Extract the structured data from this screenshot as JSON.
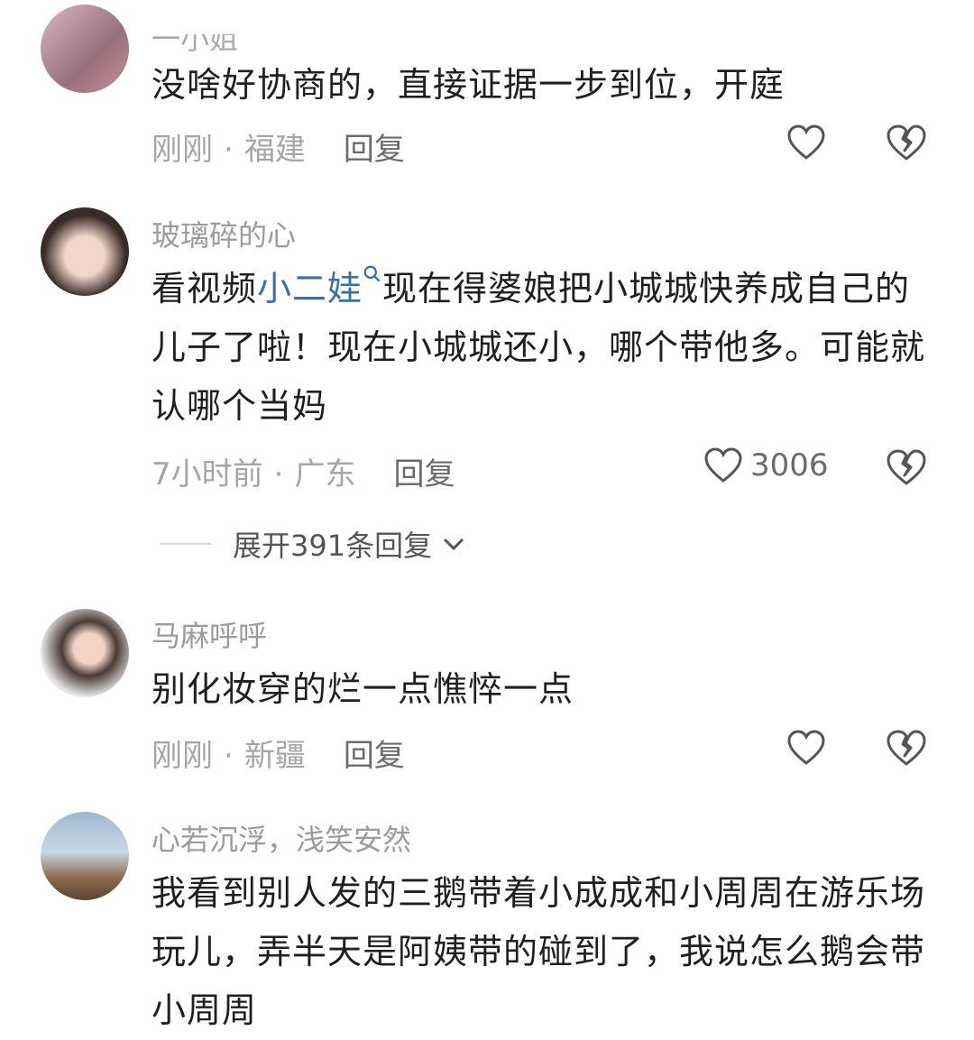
{
  "comments": [
    {
      "username": "一小姐",
      "text": "没啥好协商的，直接证据一步到位，开庭",
      "time": "刚刚",
      "location": "福建",
      "reply_label": "回复",
      "likes": ""
    },
    {
      "username": "玻璃碎的心",
      "text_before": "看视频",
      "mention": "小二娃",
      "text_after": "现在得婆娘把小城城快养成自己的儿子了啦！现在小城城还小，哪个带他多。可能就认哪个当妈",
      "time": "7小时前",
      "location": "广东",
      "reply_label": "回复",
      "likes": "3006",
      "expand_label": "展开391条回复"
    },
    {
      "username": "马麻呼呼",
      "text": "别化妆穿的烂一点憔悴一点",
      "time": "刚刚",
      "location": "新疆",
      "reply_label": "回复",
      "likes": ""
    },
    {
      "username": "心若沉浮，浅笑安然",
      "text": "我看到别人发的三鹅带着小成成和小周周在游乐场玩儿，弄半天是阿姨带的碰到了，我说怎么鹅会带小周周"
    }
  ],
  "colors": {
    "mention": "#3a6fa6",
    "meta": "#a5a5a5",
    "username": "#9b9b9b"
  },
  "icons": [
    "heart-icon",
    "broken-heart-icon",
    "search-icon",
    "chevron-down-icon"
  ]
}
